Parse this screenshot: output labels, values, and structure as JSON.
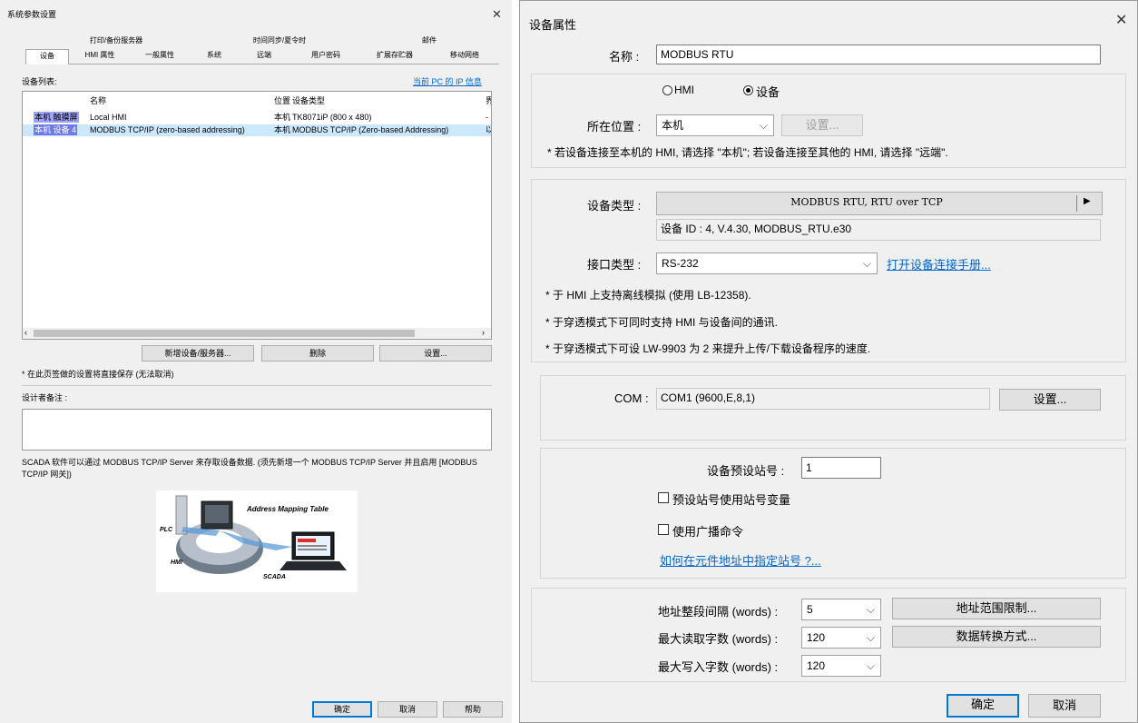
{
  "left": {
    "title": "系统参数设置",
    "tabs_row1": [
      "打印/备份服务器",
      "时间同步/夏令时",
      "邮件"
    ],
    "tabs_row2": [
      "设备",
      "HMI 属性",
      "一般属性",
      "系统",
      "远端",
      "用户密码",
      "扩展存贮器",
      "移动网络"
    ],
    "device_list_label": "设备列表:",
    "ip_link": "当前 PC 的 IP 信息",
    "columns": [
      "名称",
      "位置",
      "设备类型",
      "界"
    ],
    "rows": [
      {
        "tag": "本机 触摸屏",
        "name": "Local HMI",
        "location": "本机",
        "type": "TK8071iP (800 x 480)",
        "extra": "-"
      },
      {
        "tag": "本机 设备 4",
        "name": "MODBUS TCP/IP (zero-based addressing)",
        "location": "本机",
        "type": "MODBUS TCP/IP (Zero-based Addressing)",
        "extra": "以"
      }
    ],
    "btn_add": "新增设备/服务器...",
    "btn_delete": "删除",
    "btn_settings": "设置...",
    "save_note": "* 在此页签做的设置将直接保存 (无法取消)",
    "designer_note_label": "设计者备注 :",
    "scada_text": "SCADA 软件可以通过 MODBUS TCP/IP Server 来存取设备数据. (须先新增一个 MODBUS TCP/IP Server 并且启用 [MODBUS TCP/IP 网关])",
    "diagram": {
      "title": "Address Mapping Table",
      "plc": "PLC",
      "hmi": "HMI",
      "scada": "SCADA"
    },
    "ok": "确定",
    "cancel": "取消",
    "help": "帮助"
  },
  "right": {
    "title": "设备属性",
    "name_label": "名称 :",
    "name_value": "MODBUS RTU",
    "radio_hmi": "HMI",
    "radio_device": "设备",
    "location_label": "所在位置 :",
    "location_value": "本机",
    "location_settings": "设置...",
    "location_note": "* 若设备连接至本机的 HMI, 请选择 \"本机\"; 若设备连接至其他的 HMI, 请选择 \"远端\".",
    "device_type_label": "设备类型 :",
    "device_type_value": "MODBUS RTU, RTU over TCP",
    "device_id": "设备 ID : 4, V.4.30, MODBUS_RTU.e30",
    "interface_label": "接口类型 :",
    "interface_value": "RS-232",
    "manual_link": "打开设备连接手册...",
    "notes": [
      "* 于 HMI 上支持离线模拟 (使用 LB-12358).",
      "* 于穿透模式下可同时支持 HMI 与设备间的通讯.",
      "* 于穿透模式下可设 LW-9903 为 2 来提升上传/下载设备程序的速度."
    ],
    "com_label": "COM :",
    "com_value": "COM1 (9600,E,8,1)",
    "com_settings": "设置...",
    "station_label": "设备预设站号 :",
    "station_value": "1",
    "chk_station_var": "预设站号使用站号变量",
    "chk_broadcast": "使用广播命令",
    "station_link": "如何在元件地址中指定站号 ?...",
    "addr_interval_label": "地址整段间隔 (words) :",
    "addr_interval_value": "5",
    "max_read_label": "最大读取字数 (words) :",
    "max_read_value": "120",
    "max_write_label": "最大写入字数 (words) :",
    "max_write_value": "120",
    "addr_limit_btn": "地址范围限制...",
    "data_conv_btn": "数据转换方式...",
    "ok": "确定",
    "cancel": "取消"
  }
}
